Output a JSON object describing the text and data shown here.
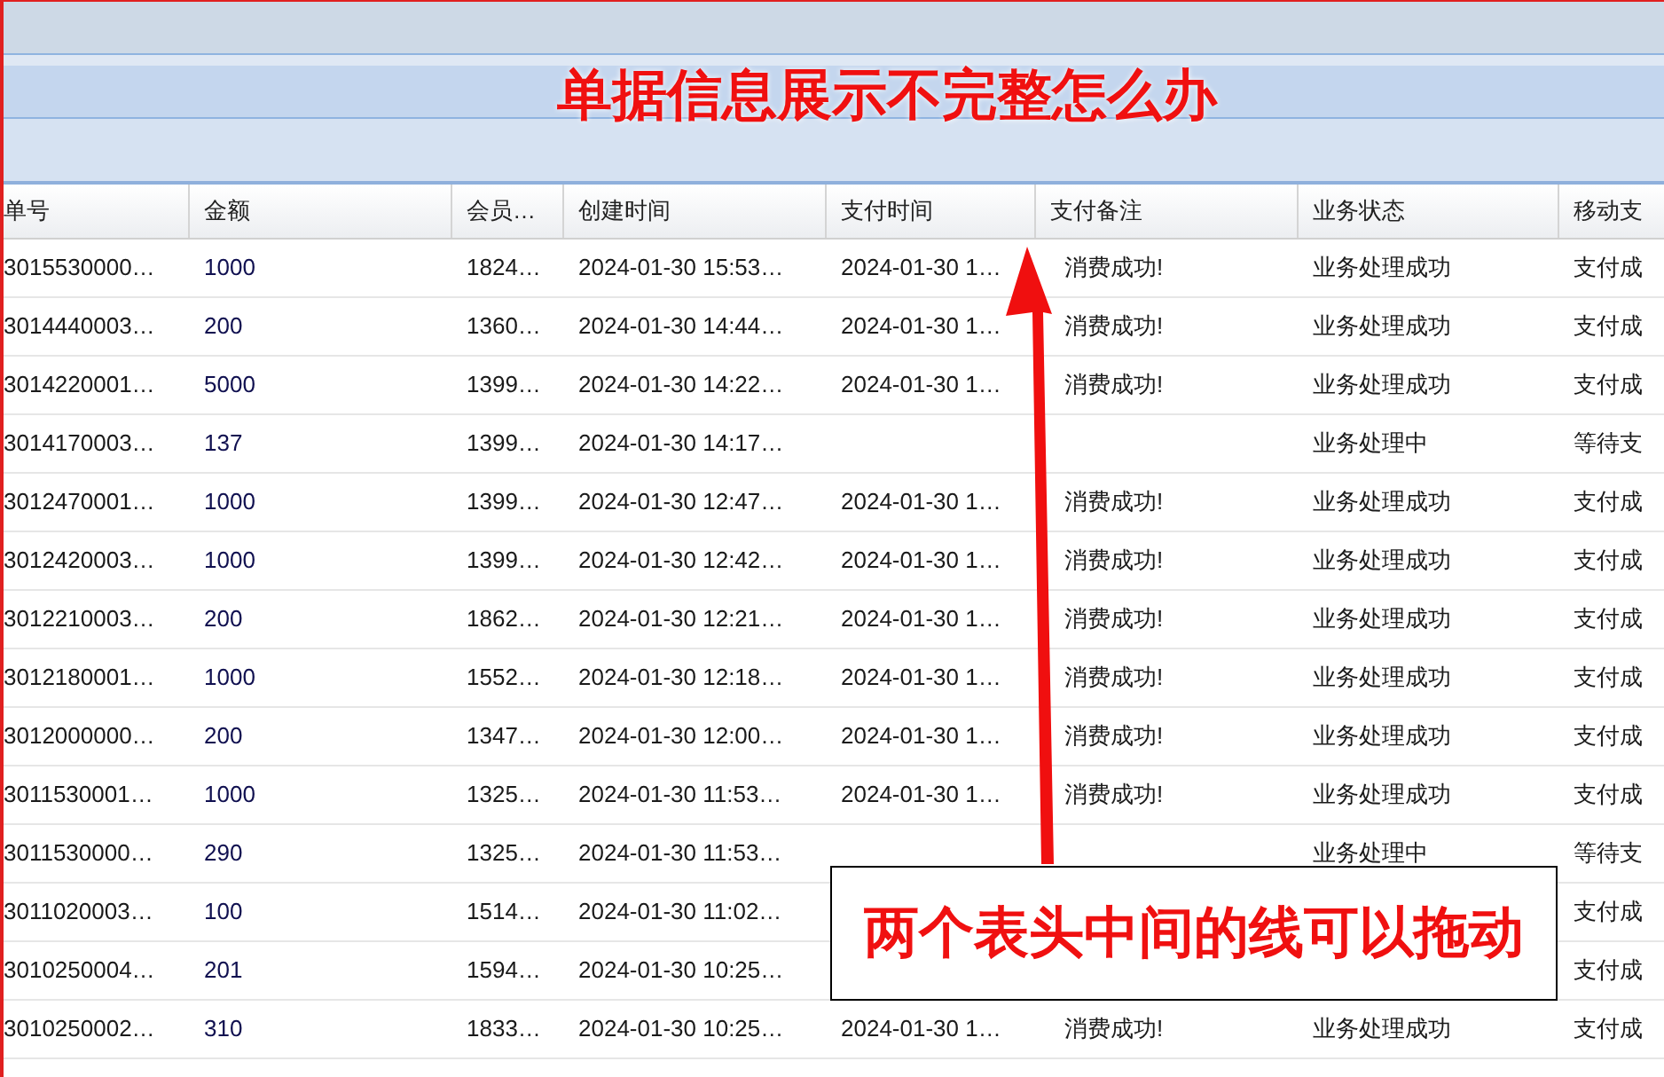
{
  "annotation_title": "单据信息展示不完整怎么办",
  "table": {
    "columns": [
      "单号",
      "金额",
      "会员…",
      "创建时间",
      "支付时间",
      "支付备注",
      "业务状态",
      "移动支"
    ],
    "rows": [
      [
        "3015530000…",
        "1000",
        "1824…",
        "2024-01-30 15:53…",
        "2024-01-30 1…",
        "消费成功!",
        "业务处理成功",
        "支付成"
      ],
      [
        "3014440003…",
        "200",
        "1360…",
        "2024-01-30 14:44…",
        "2024-01-30 1…",
        "消费成功!",
        "业务处理成功",
        "支付成"
      ],
      [
        "3014220001…",
        "5000",
        "1399…",
        "2024-01-30 14:22…",
        "2024-01-30 1…",
        "消费成功!",
        "业务处理成功",
        "支付成"
      ],
      [
        "3014170003…",
        "137",
        "1399…",
        "2024-01-30 14:17…",
        "",
        "",
        "业务处理中",
        "等待支"
      ],
      [
        "3012470001…",
        "1000",
        "1399…",
        "2024-01-30 12:47…",
        "2024-01-30 1…",
        "消费成功!",
        "业务处理成功",
        "支付成"
      ],
      [
        "3012420003…",
        "1000",
        "1399…",
        "2024-01-30 12:42…",
        "2024-01-30 1…",
        "消费成功!",
        "业务处理成功",
        "支付成"
      ],
      [
        "3012210003…",
        "200",
        "1862…",
        "2024-01-30 12:21…",
        "2024-01-30 1…",
        "消费成功!",
        "业务处理成功",
        "支付成"
      ],
      [
        "3012180001…",
        "1000",
        "1552…",
        "2024-01-30 12:18…",
        "2024-01-30 1…",
        "消费成功!",
        "业务处理成功",
        "支付成"
      ],
      [
        "3012000000…",
        "200",
        "1347…",
        "2024-01-30 12:00…",
        "2024-01-30 1…",
        "消费成功!",
        "业务处理成功",
        "支付成"
      ],
      [
        "3011530001…",
        "1000",
        "1325…",
        "2024-01-30 11:53…",
        "2024-01-30 1…",
        "消费成功!",
        "业务处理成功",
        "支付成"
      ],
      [
        "3011530000…",
        "290",
        "1325…",
        "2024-01-30 11:53…",
        "",
        "",
        "业务处理中",
        "等待支"
      ],
      [
        "3011020003…",
        "100",
        "1514…",
        "2024-01-30 11:02…",
        "",
        "",
        "",
        "支付成"
      ],
      [
        "3010250004…",
        "201",
        "1594…",
        "2024-01-30 10:25…",
        "",
        "",
        "",
        "支付成"
      ],
      [
        "3010250002…",
        "310",
        "1833…",
        "2024-01-30 10:25…",
        "2024-01-30 1…",
        "消费成功!",
        "业务处理成功",
        "支付成"
      ]
    ]
  },
  "annotation_callout": "两个表头中间的线可以拖动"
}
